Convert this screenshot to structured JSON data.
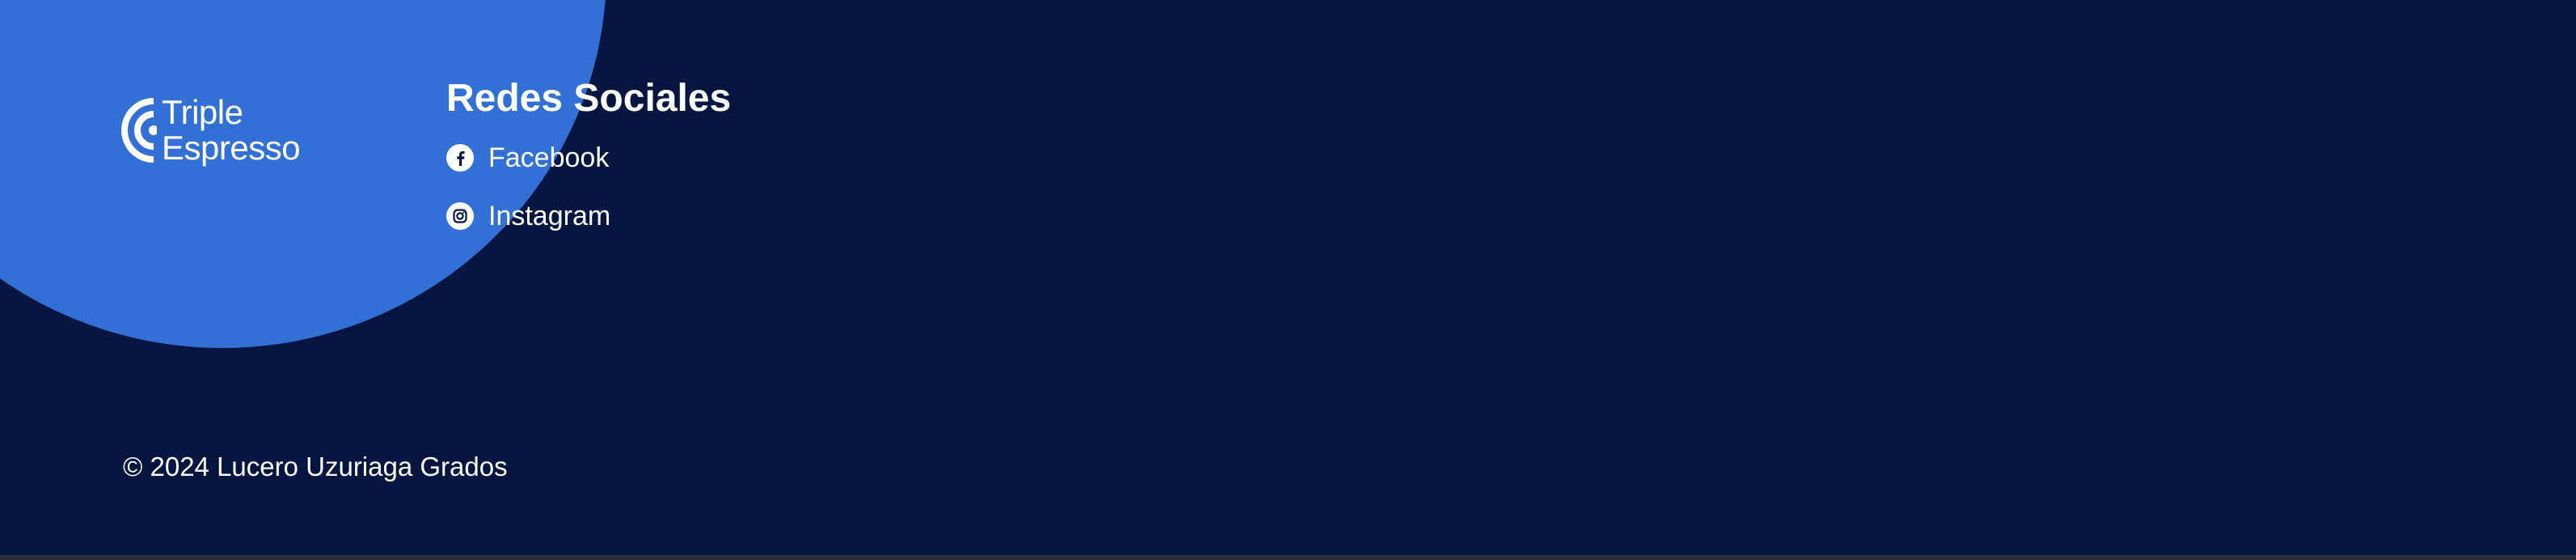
{
  "colors": {
    "background": "#061640",
    "accent_circle": "#3370d6",
    "text": "#ffffff"
  },
  "brand": {
    "logo_icon": "triple-espresso-logo-icon",
    "line1": "Triple",
    "line2": "Espresso"
  },
  "social": {
    "title": "Redes Sociales",
    "items": [
      {
        "label": "Facebook",
        "icon": "facebook-icon"
      },
      {
        "label": "Instagram",
        "icon": "instagram-icon"
      }
    ]
  },
  "footer": {
    "copyright": "© 2024 Lucero Uzuriaga Grados"
  }
}
